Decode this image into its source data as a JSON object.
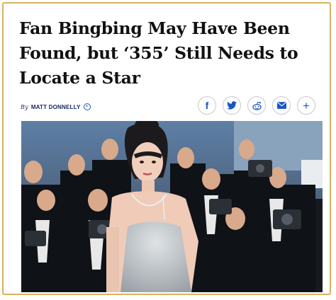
{
  "article": {
    "headline_lines": [
      "Fan Bingbing May Have Been",
      "Found, but ‘355’ Still Needs to",
      "Locate a Star"
    ],
    "byline_prefix": "By",
    "byline_author": "MATT DONNELLY"
  },
  "share": {
    "icons": [
      "facebook-icon",
      "twitter-icon",
      "reddit-icon",
      "email-icon",
      "plus-icon"
    ],
    "facebook_glyph": "f",
    "plus_glyph": "+"
  },
  "colors": {
    "frame_border": "#d8b25e",
    "byline": "#1a2a66",
    "share_icon": "#1a56c4"
  }
}
